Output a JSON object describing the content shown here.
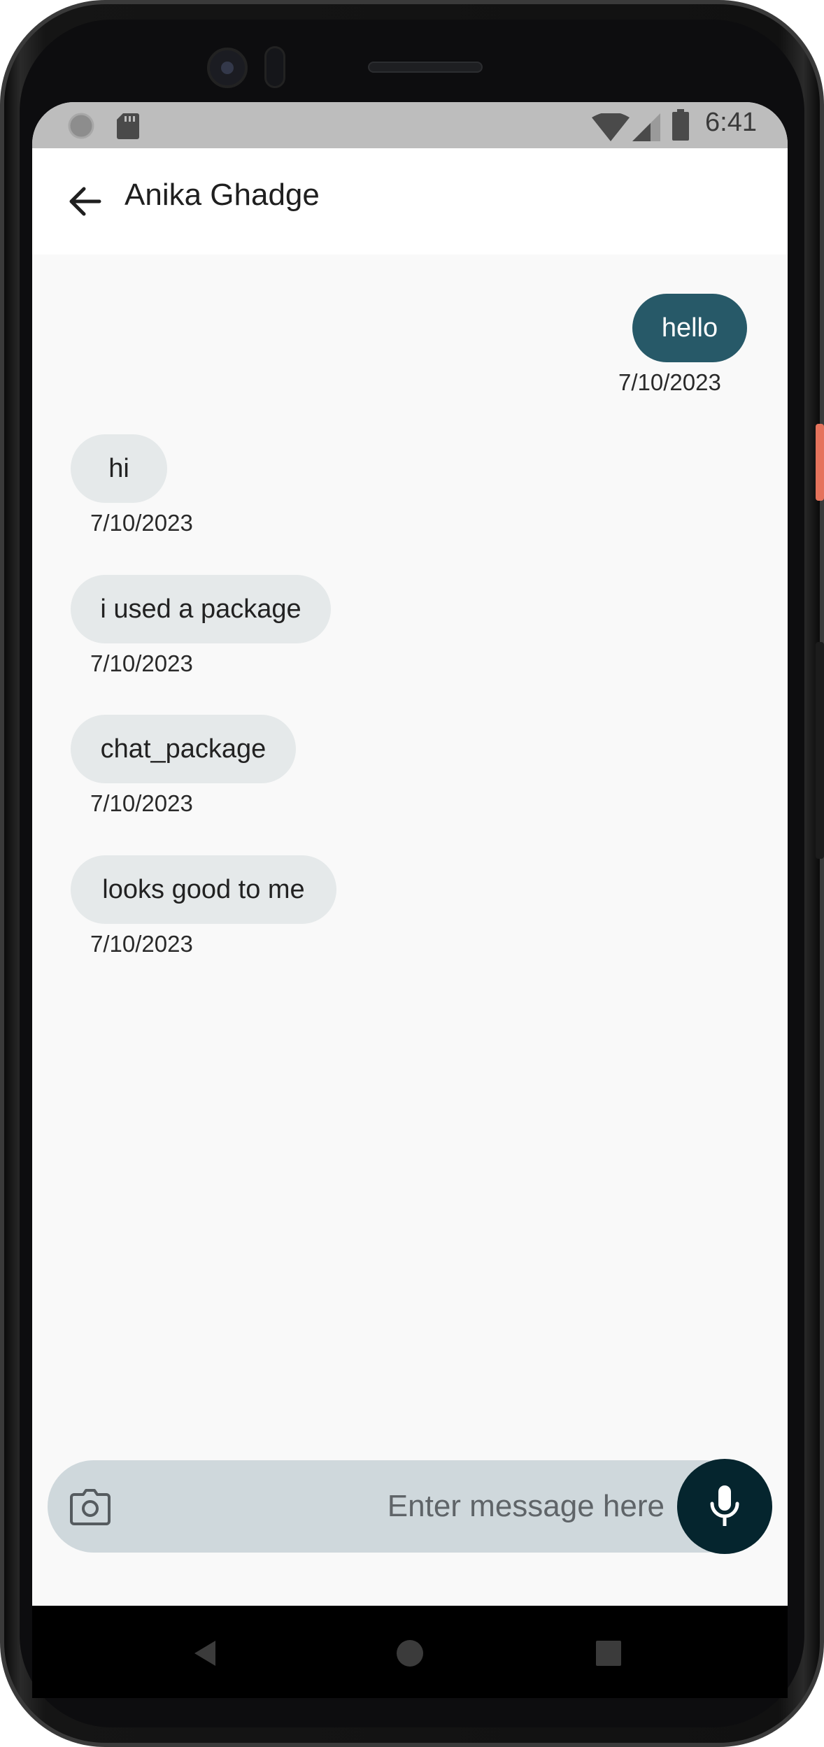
{
  "status_bar": {
    "time": "6:41",
    "left_icons": [
      "circle-status-icon",
      "sd-card-icon"
    ],
    "right_icons": [
      "wifi-icon",
      "cell-signal-icon",
      "battery-icon"
    ]
  },
  "app_bar": {
    "back_icon": "arrow-left-icon",
    "title": "Anika Ghadge"
  },
  "messages": [
    {
      "text": "hello",
      "date": "7/10/2023",
      "direction": "outgoing"
    },
    {
      "text": "hi",
      "date": "7/10/2023",
      "direction": "incoming"
    },
    {
      "text": "i used a package",
      "date": "7/10/2023",
      "direction": "incoming"
    },
    {
      "text": "chat_package",
      "date": "7/10/2023",
      "direction": "incoming"
    },
    {
      "text": "looks good to me",
      "date": "7/10/2023",
      "direction": "incoming"
    }
  ],
  "composer": {
    "camera_icon": "camera-icon",
    "placeholder": "Enter message here",
    "value": "",
    "mic_icon": "microphone-icon"
  },
  "nav_bar": {
    "items": [
      "back-triangle-icon",
      "home-circle-icon",
      "recents-square-icon"
    ]
  },
  "colors": {
    "outgoing_bubble": "#275968",
    "incoming_bubble": "#e5e9ea",
    "composer_bg": "#cfd8dc",
    "mic_button": "#05252e",
    "status_bar": "#bdbdbd"
  }
}
